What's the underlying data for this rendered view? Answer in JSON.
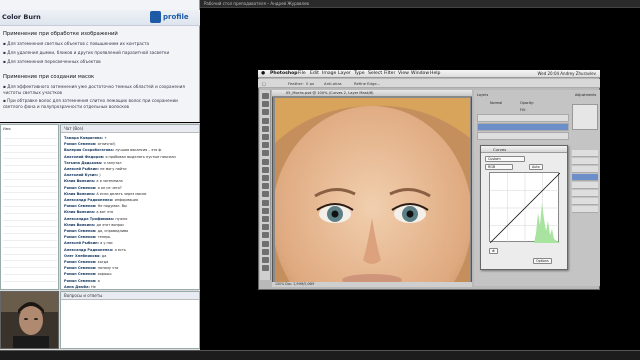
{
  "window": {
    "title": "Рабочий стол преподавателя – Андрей Журавлев"
  },
  "slide": {
    "title": "Color Burn",
    "logo_text": "profile",
    "section1": "Применение при обработке изображений",
    "items1": [
      "Для затемнения светлых объектов с повышением их контраста",
      "Для удаления дымки, бликов и других проявлений паразитной засветки",
      "Для затемнения пересвеченных объектов"
    ],
    "section2": "Применение при создании масок",
    "items2": [
      "Для эффективного затемнения уже достаточно темных областей и сохранения чистоты светлых участков",
      "При обтравке волос для затемнения слитно лежащих волос при сохранении светлого фона и полупрозрачности отдельных волосков"
    ]
  },
  "participants": {
    "rows": [
      "Имя",
      "",
      "",
      "",
      "",
      "",
      "",
      "",
      "",
      "",
      "",
      "",
      "",
      "",
      "",
      "",
      "",
      "",
      "",
      "",
      "",
      "",
      ""
    ]
  },
  "chat": {
    "header": "Чат (Все)",
    "messages": [
      {
        "author": "Тамара Ковригина:",
        "text": "+"
      },
      {
        "author": "Роман Семенов:",
        "text": "отлично!)"
      },
      {
        "author": "Валерия Скоробогатова:",
        "text": "лучшая вакансия – это ф"
      },
      {
        "author": "Анатолий Федоров:",
        "text": "я пробовал выделять пустые пиксели"
      },
      {
        "author": "Татьяна Дядькова:",
        "text": "я запутал"
      },
      {
        "author": "Алексей Рыбкин:",
        "text": "не могу найти"
      },
      {
        "author": "Анатолий Кузин:",
        "text": ")"
      },
      {
        "author": "Юлия Вилкина:",
        "text": "а я затемнила"
      },
      {
        "author": "Роман Семенов:",
        "text": "а он из чего?"
      },
      {
        "author": "Юлия Вилкина:",
        "text": "А если делать через маски"
      },
      {
        "author": "Александр Радионенко:",
        "text": "информация"
      },
      {
        "author": "Роман Семенов:",
        "text": "Не подумал. Вы"
      },
      {
        "author": "Юлия Вилкина:",
        "text": "а вот это"
      },
      {
        "author": "Александра Трофимова:",
        "text": "нужно"
      },
      {
        "author": "Юлия Вилкина:",
        "text": "да этот вопрос"
      },
      {
        "author": "Роман Семенов:",
        "text": "да, справедливо"
      },
      {
        "author": "Роман Семенов:",
        "text": "теперь"
      },
      {
        "author": "Алексей Рыбкин:",
        "text": "а у нас"
      },
      {
        "author": "Александр Радионенко:",
        "text": "а есть"
      },
      {
        "author": "Олег Хлебникова:",
        "text": "да"
      },
      {
        "author": "Роман Семенов:",
        "text": "когда"
      },
      {
        "author": "Роман Семенов:",
        "text": "потому что"
      },
      {
        "author": "Роман Семенов:",
        "text": "хорошо"
      },
      {
        "author": "Роман Семенов:",
        "text": "а"
      },
      {
        "author": "Анна Дзюба:",
        "text": "Не"
      }
    ]
  },
  "qa": {
    "header": "Вопросы и ответы"
  },
  "photoshop": {
    "menus": [
      "Photoshop",
      "File",
      "Edit",
      "Image",
      "Layer",
      "Type",
      "Select",
      "Filter",
      "View",
      "Window",
      "Help"
    ],
    "status": "Wed 20:04   Andrey Zhuravlev",
    "options": [
      "Feather:",
      "0 px",
      "Anti-alias",
      "Refine Edge..."
    ],
    "doc_title": "05_Mochs.psd @ 100% (Curves 2, Layer Mask/8)",
    "doc_status": "100%   Doc: 2,99M/5,06M",
    "curves_title": "Curves",
    "curves_preset": "Custom",
    "curves_channel": "RGB",
    "curves_buttons": [
      "Auto",
      "Options"
    ],
    "panel_labels": [
      "Layers",
      "Normal",
      "Opacity:",
      "Fill:",
      "Adjustments"
    ]
  },
  "colors": {
    "accent": "#1f5aa6",
    "ps_select": "#6d8fc9"
  }
}
